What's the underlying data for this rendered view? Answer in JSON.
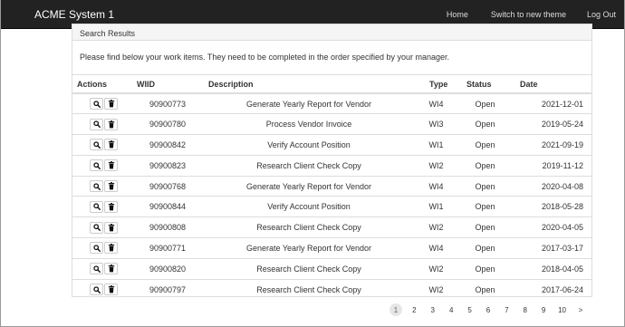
{
  "navbar": {
    "brand": "ACME System 1",
    "links": [
      "Home",
      "Switch to new theme",
      "Log Out"
    ]
  },
  "panel": {
    "heading": "Search Results",
    "intro": "Please find below your work items. They need to be completed in the order specified by your manager."
  },
  "table": {
    "columns": [
      "Actions",
      "WIID",
      "Description",
      "Type",
      "Status",
      "Date"
    ],
    "row_action_icons": [
      "search-icon",
      "trash-icon"
    ],
    "rows": [
      {
        "wiid": "90900773",
        "description": "Generate Yearly Report for Vendor",
        "type": "WI4",
        "status": "Open",
        "date": "2021-12-01"
      },
      {
        "wiid": "90900780",
        "description": "Process Vendor Invoice",
        "type": "WI3",
        "status": "Open",
        "date": "2019-05-24"
      },
      {
        "wiid": "90900842",
        "description": "Verify Account Position",
        "type": "WI1",
        "status": "Open",
        "date": "2021-09-19"
      },
      {
        "wiid": "90900823",
        "description": "Research Client Check Copy",
        "type": "WI2",
        "status": "Open",
        "date": "2019-11-12"
      },
      {
        "wiid": "90900768",
        "description": "Generate Yearly Report for Vendor",
        "type": "WI4",
        "status": "Open",
        "date": "2020-04-08"
      },
      {
        "wiid": "90900844",
        "description": "Verify Account Position",
        "type": "WI1",
        "status": "Open",
        "date": "2018-05-28"
      },
      {
        "wiid": "90900808",
        "description": "Research Client Check Copy",
        "type": "WI2",
        "status": "Open",
        "date": "2020-04-05"
      },
      {
        "wiid": "90900771",
        "description": "Generate Yearly Report for Vendor",
        "type": "WI4",
        "status": "Open",
        "date": "2017-03-17"
      },
      {
        "wiid": "90900820",
        "description": "Research Client Check Copy",
        "type": "WI2",
        "status": "Open",
        "date": "2018-04-05"
      },
      {
        "wiid": "90900797",
        "description": "Research Client Check Copy",
        "type": "WI2",
        "status": "Open",
        "date": "2017-06-24"
      }
    ]
  },
  "pagination": {
    "pages": [
      "1",
      "2",
      "3",
      "4",
      "5",
      "6",
      "7",
      "8",
      "9",
      "10",
      ">"
    ],
    "current_page": "1"
  },
  "colors": {
    "navbar_bg": "#222222",
    "navbar_text": "#dcdcdc",
    "active_page_bg": "#e6e6e6"
  }
}
